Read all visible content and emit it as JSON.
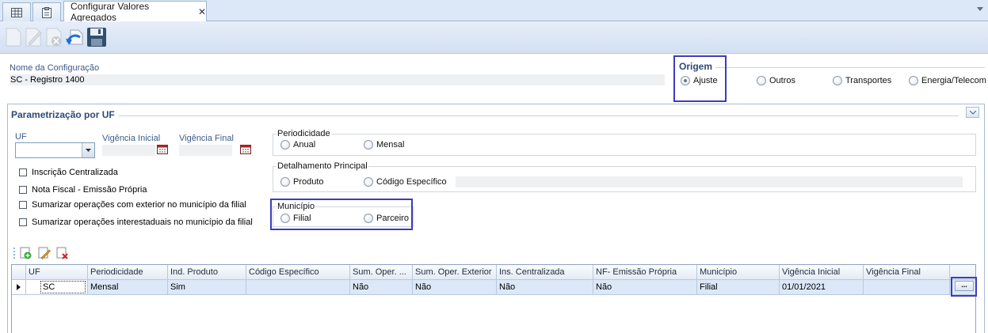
{
  "tabs": {
    "main_label": "Configurar Valores Agregados",
    "close_glyph": "✕",
    "icons": [
      "grid-icon",
      "clipboard-icon"
    ]
  },
  "toolbar": {
    "buttons": [
      "new-document-icon",
      "edit-icon",
      "delete-icon",
      "undo-icon",
      "save-icon"
    ]
  },
  "header": {
    "config_name_label": "Nome da Configuração",
    "config_name_value": "SC - Registro 1400",
    "origem": {
      "title": "Origem",
      "options": [
        "Ajuste",
        "Outros",
        "Transportes",
        "Energia/Telecom"
      ],
      "selected": "Ajuste"
    }
  },
  "group": {
    "title": "Parametrização por UF",
    "uf_label": "UF",
    "vigencia_inicial_label": "Vigência Inicial",
    "vigencia_final_label": "Vigência Final",
    "checkboxes": [
      "Inscrição Centralizada",
      "Nota Fiscal - Emissão Própria",
      "Sumarizar operações com exterior no município da filial",
      "Sumarizar operações interestaduais no município da filial"
    ],
    "periodicidade": {
      "legend": "Periodicidade",
      "options": [
        "Anual",
        "Mensal"
      ]
    },
    "detalhamento": {
      "legend": "Detalhamento Principal",
      "options": [
        "Produto",
        "Código Específico"
      ]
    },
    "municipio": {
      "legend": "Município",
      "options": [
        "Filial",
        "Parceiro"
      ]
    }
  },
  "grid": {
    "toolbar_icons": [
      "add-row-icon",
      "edit-row-icon",
      "delete-row-icon"
    ],
    "columns": [
      "UF",
      "Periodicidade",
      "Ind. Produto",
      "Código Específico",
      "Sum. Oper. ...",
      "Sum. Oper. Exterior",
      "Ins. Centralizada",
      "NF- Emissão Própria",
      "Município",
      "Vigência Inicial",
      "Vigência Final"
    ],
    "rows": [
      [
        "SC",
        "Mensal",
        "Sim",
        "",
        "Não",
        "Não",
        "Não",
        "Não",
        "Filial",
        "01/01/2021",
        ""
      ]
    ],
    "ellipsis_label": "..."
  },
  "colors": {
    "highlight": "#3c3cbf",
    "header_blue": "#2c4a77",
    "toolbar_bg": "#dce8f7",
    "selected_row": "#dce8f8"
  }
}
